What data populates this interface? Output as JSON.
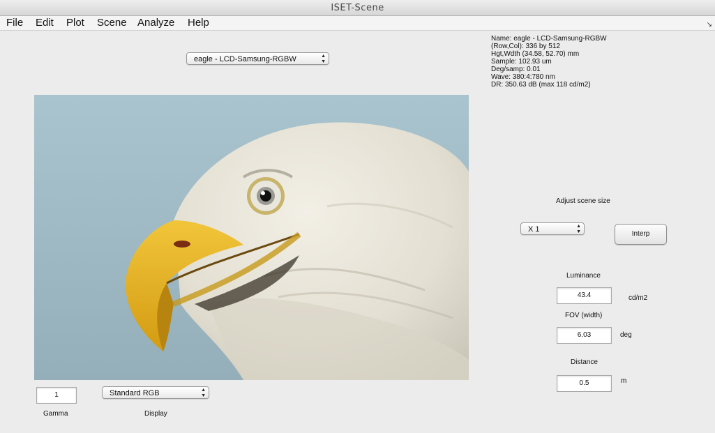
{
  "window": {
    "title": "ISET-Scene"
  },
  "menubar": {
    "items": [
      {
        "label": "File"
      },
      {
        "label": "Edit"
      },
      {
        "label": "Plot"
      },
      {
        "label": "Scene"
      },
      {
        "label": "Analyze"
      },
      {
        "label": "Help"
      }
    ],
    "resize_icon": "diagonal-arrow-icon"
  },
  "scene_select": {
    "value": "eagle - LCD-Samsung-RGBW"
  },
  "info": {
    "lines": [
      "Name: eagle - LCD-Samsung-RGBW",
      "(Row,Col): 336 by 512",
      "Hgt,Wdth (34.58, 52.70) mm",
      "Sample: 102.93 um",
      "Deg/samp: 0.01",
      "Wave: 380:4:780 nm",
      "DR: 350.63 dB (max 118 cd/m2)"
    ]
  },
  "size_controls": {
    "adjust_label": "Adjust scene size",
    "size_value": "X 1",
    "interp_label": "Interp"
  },
  "luminance": {
    "label": "Luminance",
    "value": "43.4",
    "unit": "cd/m2"
  },
  "fov": {
    "label": "FOV (width)",
    "value": "6.03",
    "unit": "deg"
  },
  "distance": {
    "label": "Distance",
    "value": "0.5",
    "unit": "m"
  },
  "gamma": {
    "label": "Gamma",
    "value": "1"
  },
  "display": {
    "label": "Display",
    "value": "Standard RGB"
  },
  "colors": {
    "sky": "#9bb6c2",
    "feathers": "#e9e6dc",
    "beak": "#e5b321",
    "eye_ring": "#c8b46a"
  }
}
